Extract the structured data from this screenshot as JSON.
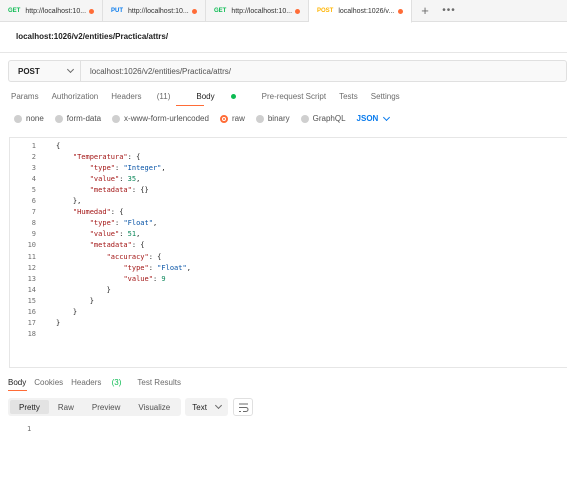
{
  "tabs": [
    {
      "method": "GET",
      "method_color": "#0cbb52",
      "label": "http://localhost:10...",
      "active": false
    },
    {
      "method": "PUT",
      "method_color": "#097bed",
      "label": "http://localhost:10...",
      "active": false
    },
    {
      "method": "GET",
      "method_color": "#0cbb52",
      "label": "http://localhost:10...",
      "active": false
    },
    {
      "method": "POST",
      "method_color": "#ffb400",
      "label": "localhost:1026/v...",
      "active": true
    }
  ],
  "request": {
    "title": "localhost:1026/v2/entities/Practica/attrs/",
    "method": "POST",
    "url": "localhost:1026/v2/entities/Practica/attrs/"
  },
  "request_tabs": {
    "params": "Params",
    "authorization": "Authorization",
    "headers": "Headers",
    "headers_count": "(11)",
    "body": "Body",
    "prerequest": "Pre-request Script",
    "tests": "Tests",
    "settings": "Settings"
  },
  "body_types": {
    "none": "none",
    "form_data": "form-data",
    "urlencoded": "x-www-form-urlencoded",
    "raw": "raw",
    "binary": "binary",
    "graphql": "GraphQL",
    "language": "JSON"
  },
  "editor": {
    "lines": [
      {
        "n": "1",
        "code": "{"
      },
      {
        "n": "2",
        "code": "    \"Temperatura\": {"
      },
      {
        "n": "3",
        "code": "        \"type\": \"Integer\","
      },
      {
        "n": "4",
        "code": "        \"value\": 35,"
      },
      {
        "n": "5",
        "code": "        \"metadata\": {}"
      },
      {
        "n": "6",
        "code": "    },"
      },
      {
        "n": "7",
        "code": "    \"Humedad\": {"
      },
      {
        "n": "8",
        "code": "        \"type\": \"Float\","
      },
      {
        "n": "9",
        "code": "        \"value\": 51,"
      },
      {
        "n": "10",
        "code": "        \"metadata\": {"
      },
      {
        "n": "11",
        "code": "            \"accuracy\": {"
      },
      {
        "n": "12",
        "code": "                \"type\": \"Float\","
      },
      {
        "n": "13",
        "code": "                \"value\": 9"
      },
      {
        "n": "14",
        "code": "            }"
      },
      {
        "n": "15",
        "code": "        }"
      },
      {
        "n": "16",
        "code": "    }"
      },
      {
        "n": "17",
        "code": "}"
      },
      {
        "n": "18",
        "code": ""
      }
    ]
  },
  "response_tabs": {
    "body": "Body",
    "cookies": "Cookies",
    "headers": "Headers",
    "headers_count": "(3)",
    "test_results": "Test Results"
  },
  "response_toolbar": {
    "pretty": "Pretty",
    "raw": "Raw",
    "preview": "Preview",
    "visualize": "Visualize",
    "format": "Text"
  },
  "response": {
    "line_number": "1"
  },
  "colors": {
    "accent": "#ff6c37",
    "active_tab_indicator": "#0cbb52",
    "json_link": "#097bed"
  }
}
